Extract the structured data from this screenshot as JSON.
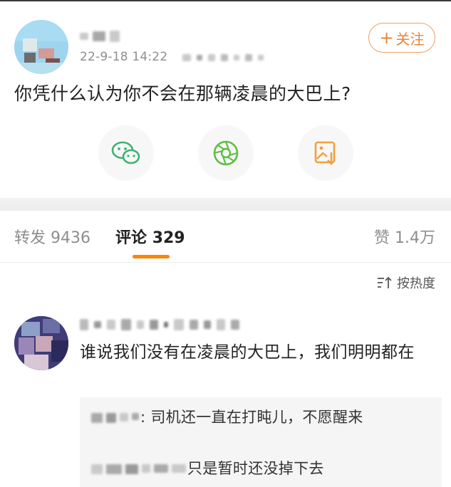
{
  "post": {
    "time": "22-9-18 14:22",
    "text": "你凭什么认为你不会在那辆凌晨的大巴上?",
    "follow_plus": "+",
    "follow_label": "关注"
  },
  "share": {
    "items": [
      "wechat-icon",
      "moments-icon",
      "save-image-icon"
    ]
  },
  "tabs": {
    "repost_label": "转发",
    "repost_count": "9436",
    "comments_label": "评论",
    "comments_count": "329",
    "likes_label": "赞",
    "likes_count": "1.4万"
  },
  "sort": {
    "label": "按热度"
  },
  "comment": {
    "text": "谁说我们没有在凌晨的大巴上，我们明明都在",
    "replies": [
      {
        "text": ": 司机还一直在打盹儿，不愿醒来"
      },
      {
        "text": "只是暂时还没掉下去"
      }
    ]
  },
  "colors": {
    "accent": "#ff8200",
    "follow": "#e8843a",
    "wechat": "#3cb371",
    "moments": "#5fbf3f",
    "save": "#f0a040"
  }
}
